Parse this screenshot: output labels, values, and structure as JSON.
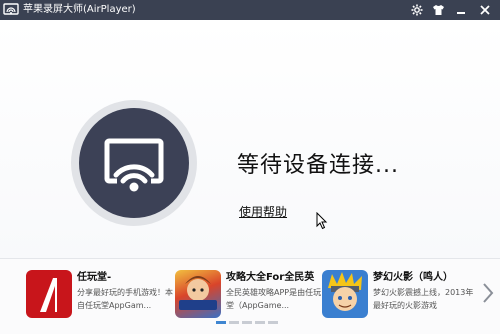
{
  "titlebar": {
    "title": "苹果录屏大师(AirPlayer)",
    "icons": [
      "airplay-app-icon",
      "gear-icon",
      "shirt-icon",
      "minimize-icon",
      "close-icon"
    ]
  },
  "main": {
    "status_text": "等待设备连接...",
    "help_link": "使用帮助"
  },
  "apps": [
    {
      "name": "任玩堂-",
      "desc_line1": "分享最好玩的手机游戏！本",
      "desc_line2": "自任玩堂AppGam...",
      "thumb": "renwantang-logo"
    },
    {
      "name": "攻略大全For全民英",
      "desc_line1": "全民英雄攻略APP是由任玩",
      "desc_line2": "堂（AppGame...",
      "thumb": "game-hero-art"
    },
    {
      "name": "梦幻火影（鸣人）",
      "desc_line1": "梦幻火影震撼上线，2013年",
      "desc_line2": "最好玩的火影游戏",
      "thumb": "naruto-art"
    }
  ],
  "pager": {
    "count": 5,
    "active_index": 0
  },
  "colors": {
    "titlebar": "#3a4152",
    "disc": "#3c4156",
    "ring": "#e1e3e7",
    "pager_active": "#3f86d1"
  }
}
